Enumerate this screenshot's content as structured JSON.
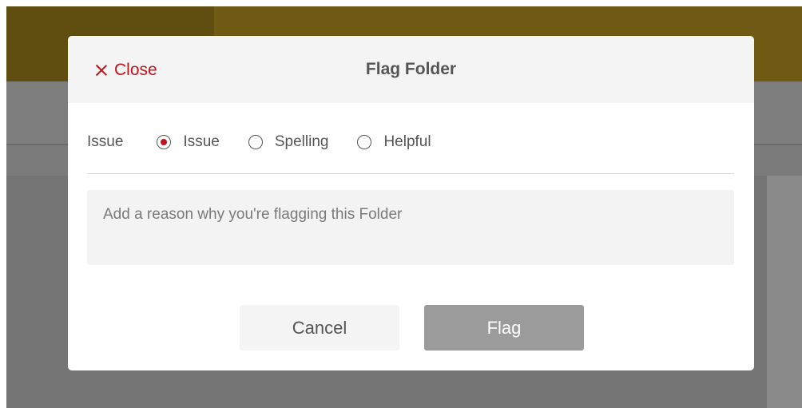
{
  "modal": {
    "title": "Flag Folder",
    "close_label": "Close",
    "issue_label": "Issue",
    "options": [
      {
        "label": "Issue",
        "checked": true
      },
      {
        "label": "Spelling",
        "checked": false
      },
      {
        "label": "Helpful",
        "checked": false
      }
    ],
    "reason_placeholder": "Add a reason why you're flagging this Folder",
    "cancel_label": "Cancel",
    "flag_label": "Flag"
  },
  "colors": {
    "accent": "#c0141c",
    "header_bg": "#f4f4f4",
    "flag_button_bg": "#9b9b9b",
    "overlay": "#757575",
    "background_banner": "#6e5a12"
  },
  "icons": {
    "close": "close-icon",
    "radio": "radio-icon"
  }
}
